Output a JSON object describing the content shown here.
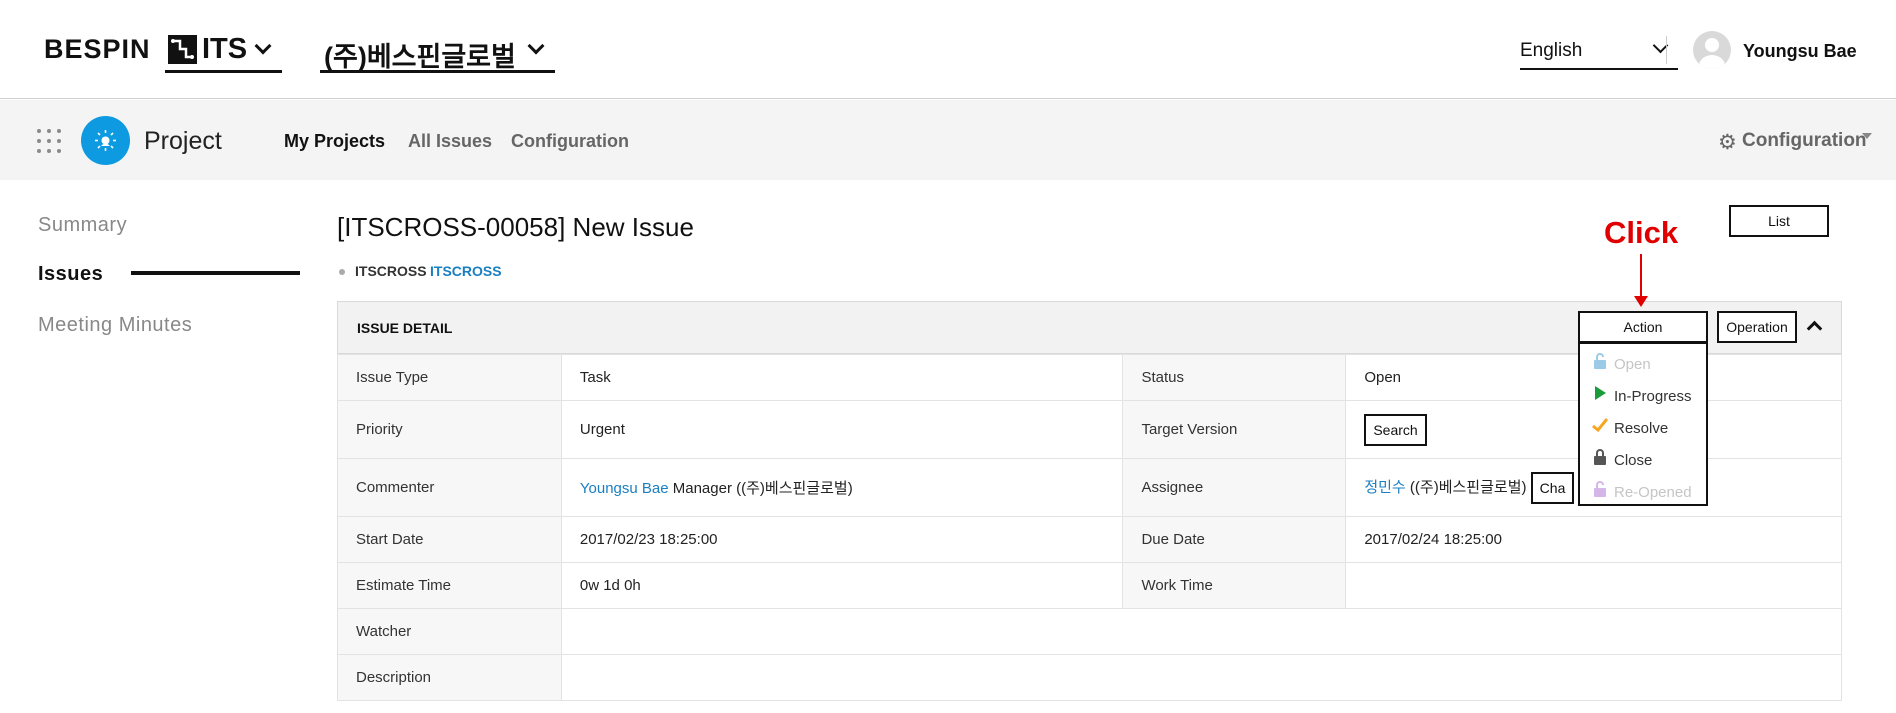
{
  "header": {
    "logo": "BESPIN",
    "service_label": "ITS",
    "company_label": "(주)베스핀글로벌",
    "language": "English",
    "user_name": "Youngsu Bae"
  },
  "nav": {
    "project_title": "Project",
    "links": [
      "My Projects",
      "All Issues",
      "Configuration"
    ],
    "active": "My Projects",
    "right_config": "Configuration"
  },
  "left_menu": {
    "items": [
      "Summary",
      "Issues",
      "Meeting Minutes"
    ],
    "active": "Issues"
  },
  "issue": {
    "title": "[ITSCROSS-00058] New Issue",
    "list_button": "List",
    "breadcrumb": [
      "ITSCROSS",
      "ITSCROSS"
    ],
    "panel_title": "ISSUE DETAIL",
    "action_button": "Action",
    "operation_button": "Operation",
    "rows": {
      "issue_type": {
        "label": "Issue Type",
        "value": "Task"
      },
      "status": {
        "label": "Status",
        "value": "Open"
      },
      "priority": {
        "label": "Priority",
        "value": "Urgent"
      },
      "target_version": {
        "label": "Target Version",
        "button": "Search"
      },
      "commenter": {
        "label": "Commenter",
        "name": "Youngsu Bae",
        "rest": "Manager ((주)베스핀글로벌)"
      },
      "assignee": {
        "label": "Assignee",
        "name": "정민수",
        "rest": "((주)베스핀글로벌)",
        "button": "Cha"
      },
      "start_date": {
        "label": "Start Date",
        "value": "2017/02/23 18:25:00"
      },
      "due_date": {
        "label": "Due Date",
        "value": "2017/02/24 18:25:00"
      },
      "estimate_time": {
        "label": "Estimate Time",
        "value": "0w 1d 0h"
      },
      "work_time": {
        "label": "Work Time",
        "value": ""
      },
      "watcher": {
        "label": "Watcher",
        "value": ""
      },
      "description": {
        "label": "Description",
        "value": ""
      }
    }
  },
  "action_menu": {
    "items": [
      {
        "label": "Open",
        "icon": "unlock-icon",
        "enabled": false
      },
      {
        "label": "In-Progress",
        "icon": "play-icon",
        "enabled": true
      },
      {
        "label": "Resolve",
        "icon": "check-icon",
        "enabled": true
      },
      {
        "label": "Close",
        "icon": "lock-icon",
        "enabled": true
      },
      {
        "label": "Re-Opened",
        "icon": "unlock-icon",
        "enabled": false
      }
    ]
  },
  "annotation": {
    "text": "Click",
    "color": "#e00000"
  },
  "colors": {
    "brand_blue": "#0d9ae0",
    "link_blue": "#1a7fc1",
    "play_green": "#1a9c3a",
    "check_orange": "#f5a623"
  }
}
